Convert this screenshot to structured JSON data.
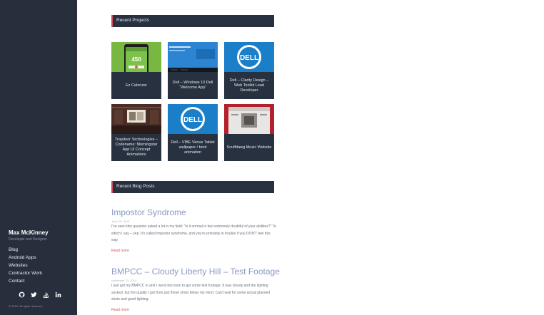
{
  "sidebar": {
    "name": "Max McKinney",
    "tagline": "Developer and Designer",
    "nav": [
      {
        "label": "Blog"
      },
      {
        "label": "Android Apps"
      },
      {
        "label": "Websites"
      },
      {
        "label": "Contractor Work"
      },
      {
        "label": "Contact"
      }
    ],
    "social_icons": [
      "github-icon",
      "twitter-icon",
      "stackoverflow-icon",
      "linkedin-icon"
    ],
    "copyright": "© 2015. All rights reserved."
  },
  "projects": {
    "heading": "Recent Projects",
    "items": [
      {
        "caption": "Ez Calorizer",
        "thumb_text": "450"
      },
      {
        "caption": "Dell – Windows 10 Dell “Welcome App”"
      },
      {
        "caption": "Dell – Clarity Design – Web Toolkit Lead Developer",
        "thumb_text": "DELL"
      },
      {
        "caption": "Trapdoor Technologies – Codename: Morningstar App UI Concept Animations"
      },
      {
        "caption": "Dell – VIBE Venue Tablet wallpaper / boot animation",
        "thumb_text": "DELL"
      },
      {
        "caption": "Scuffdawg Music Website"
      }
    ]
  },
  "blog": {
    "heading": "Recent Blog Posts",
    "posts": [
      {
        "title": "Impostor Syndrome",
        "date": "June 29, 2015",
        "body": "I've seen this question asked a lot in my field: \"Is it normal to feel extremely doubtful of your abilities?\" To which I say – yep. It's called impostor syndrome, and you're probably in trouble if you DON'T feel this way.",
        "read_more": "Read more"
      },
      {
        "title": "BMPCC – Cloudy Liberty Hill – Test Footage",
        "date": "November 13, 2014",
        "body": "I just got my BMPCC in and I went into town to get some test footage. It was cloudy and the lighting sucked, but the quality I got from just these shots blows my mind. Can't wait for some actual planned shots and good lighting.",
        "read_more": "Read more"
      }
    ]
  },
  "colors": {
    "sidebar_bg": "#272f3d",
    "accent_red": "#d34a5b",
    "title_blue": "#8b99c2",
    "dell_blue": "#1a7fc8",
    "ez_green": "#78b840"
  }
}
